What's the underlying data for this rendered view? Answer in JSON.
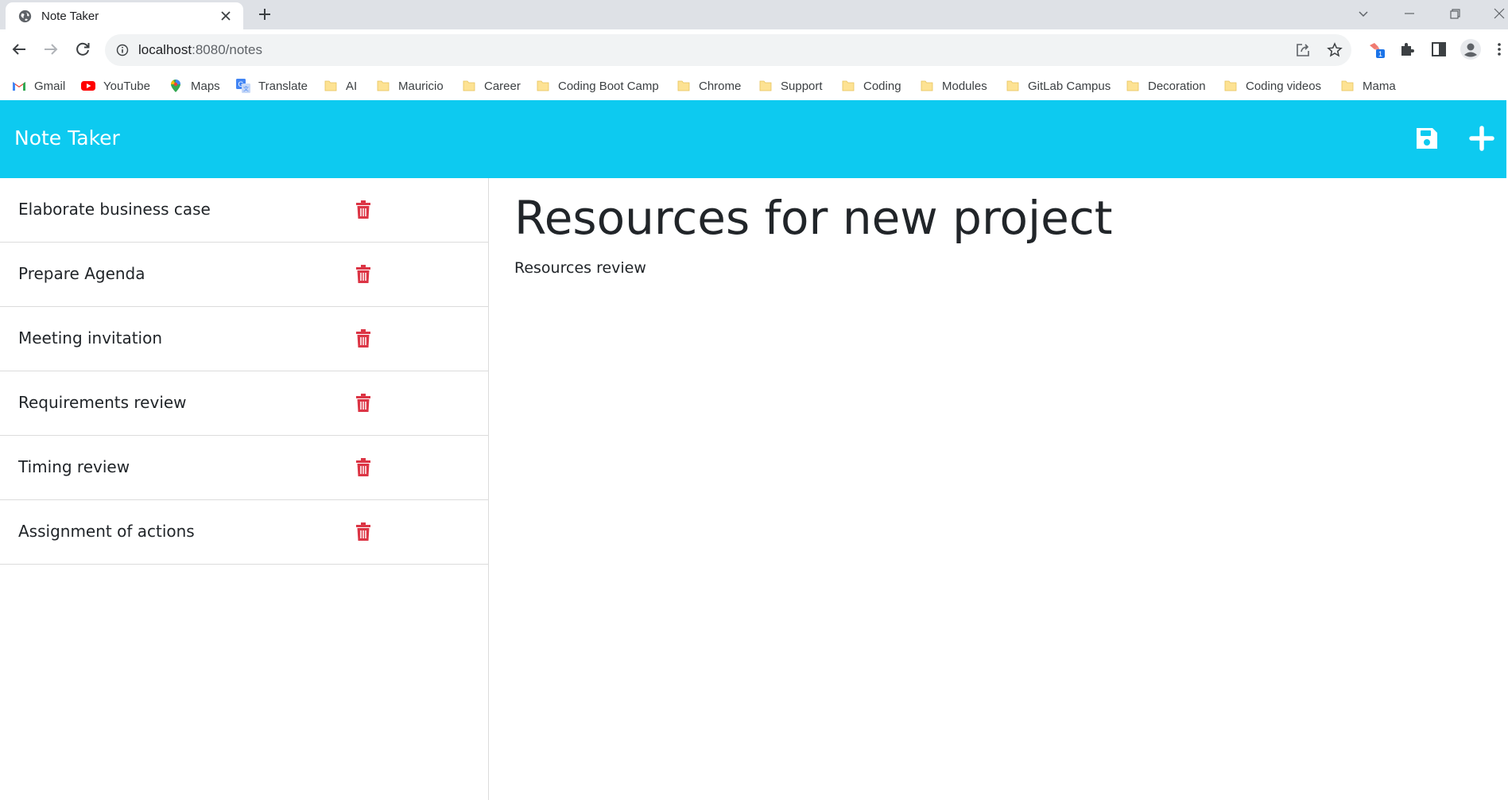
{
  "browser": {
    "tab": {
      "title": "Note Taker"
    },
    "url": {
      "host": "localhost",
      "rest": ":8080/notes"
    },
    "extension_badge": "1",
    "bookmarks": [
      {
        "label": "Gmail",
        "icon": "gmail-icon"
      },
      {
        "label": "YouTube",
        "icon": "youtube-icon"
      },
      {
        "label": "Maps",
        "icon": "maps-icon"
      },
      {
        "label": "Translate",
        "icon": "translate-icon"
      },
      {
        "label": "AI",
        "icon": "folder-icon"
      },
      {
        "label": "Mauricio",
        "icon": "folder-icon"
      },
      {
        "label": "Career",
        "icon": "folder-icon"
      },
      {
        "label": "Coding Boot Camp",
        "icon": "folder-icon"
      },
      {
        "label": "Chrome",
        "icon": "folder-icon"
      },
      {
        "label": "Support",
        "icon": "folder-icon"
      },
      {
        "label": "Coding",
        "icon": "folder-icon"
      },
      {
        "label": "Modules",
        "icon": "folder-icon"
      },
      {
        "label": "GitLab Campus",
        "icon": "folder-icon"
      },
      {
        "label": "Decoration",
        "icon": "folder-icon"
      },
      {
        "label": "Coding videos",
        "icon": "folder-icon"
      },
      {
        "label": "Mama",
        "icon": "folder-icon"
      }
    ]
  },
  "app": {
    "title": "Note Taker",
    "accent_color": "#0dcaf0",
    "delete_color": "#dc3545",
    "actions": {
      "save_icon": "save-icon",
      "new_icon": "plus-icon"
    }
  },
  "notes": [
    {
      "title": "Elaborate business case"
    },
    {
      "title": "Prepare Agenda"
    },
    {
      "title": "Meeting invitation"
    },
    {
      "title": "Requirements review"
    },
    {
      "title": "Timing review"
    },
    {
      "title": "Assignment of actions"
    }
  ],
  "active_note": {
    "title": "Resources for new project",
    "text": "Resources review"
  }
}
